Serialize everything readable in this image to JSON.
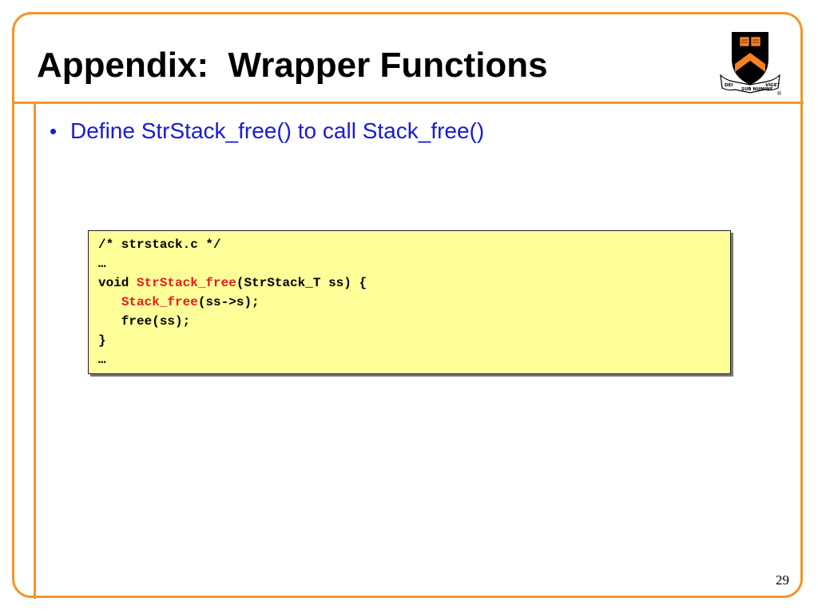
{
  "slide": {
    "title": "Appendix:  Wrapper Functions",
    "page_number": "29"
  },
  "bullets": [
    {
      "text": "Define StrStack_free() to call Stack_free()"
    }
  ],
  "code": {
    "line1": "/* strstack.c */",
    "line2": "…",
    "line3": {
      "pre": "void ",
      "highlight": "StrStack_free",
      "post": "(StrStack_T ss) {"
    },
    "line4": {
      "indent": "   ",
      "highlight": "Stack_free",
      "post": "(ss->s);"
    },
    "line5": "   free(ss);",
    "line6": "}",
    "line7": "…"
  },
  "logo": {
    "name": "princeton-shield",
    "motto_left": "DEI",
    "motto_center": "SUB NUMINE",
    "motto_right": "VIGET",
    "registered_mark": "®"
  },
  "colors": {
    "frame": "#f0962a",
    "bullet_text": "#1a1ad6",
    "code_background": "#ffff99",
    "code_highlight": "#e21d1d",
    "shield_orange": "#f58025",
    "shield_black": "#000000"
  }
}
